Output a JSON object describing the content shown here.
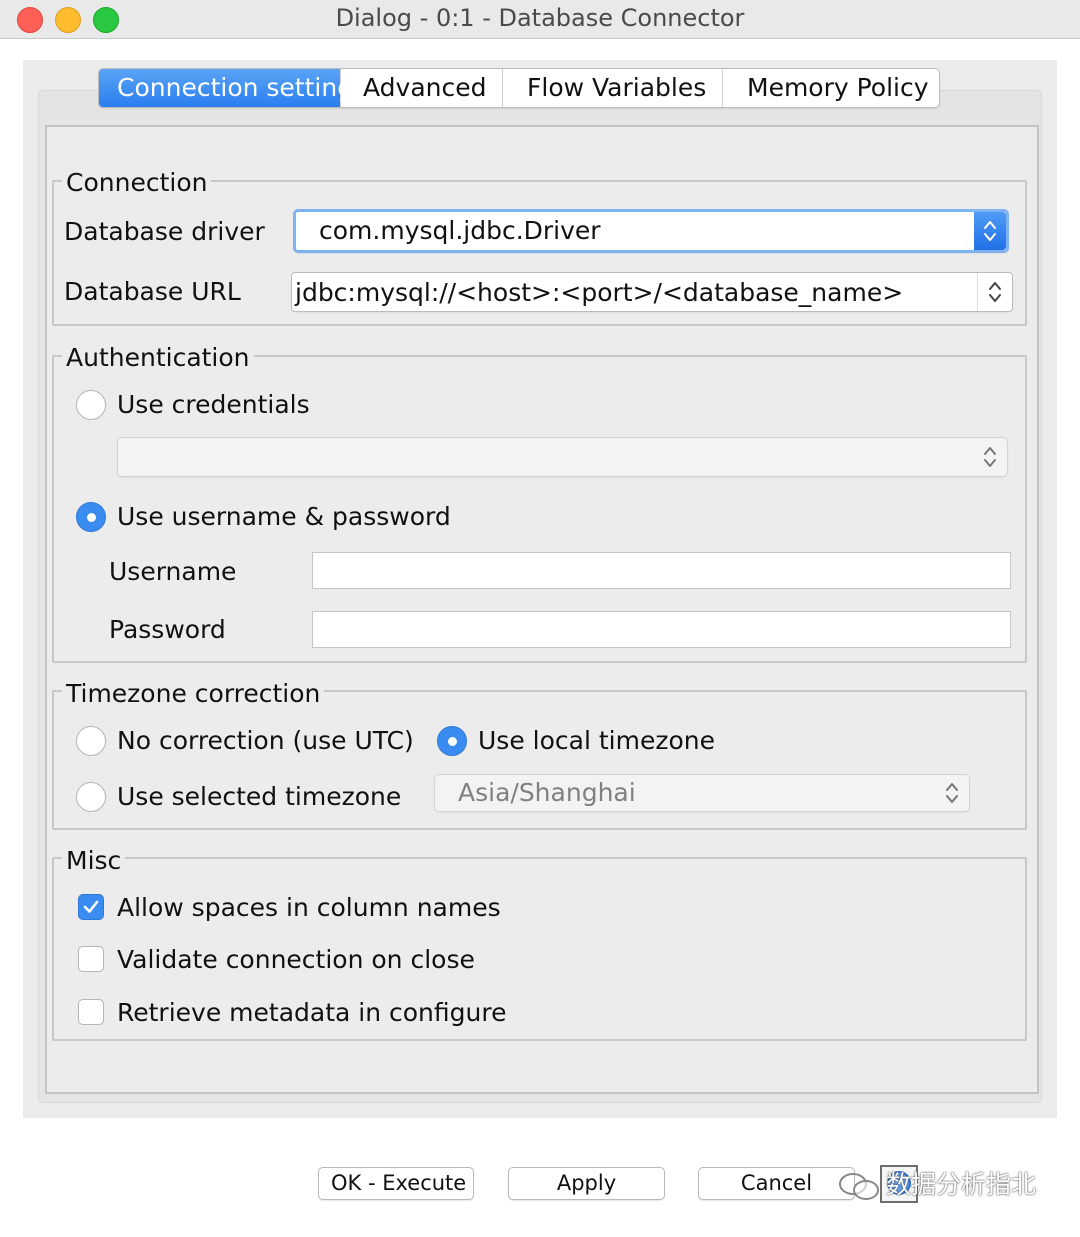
{
  "window": {
    "title": "Dialog - 0:1 - Database Connector"
  },
  "tabs": [
    {
      "label": "Connection settings",
      "active": true
    },
    {
      "label": "Advanced",
      "active": false
    },
    {
      "label": "Flow Variables",
      "active": false
    },
    {
      "label": "Memory Policy",
      "active": false
    }
  ],
  "connection": {
    "title": "Connection",
    "driver_label": "Database driver",
    "driver_value": "com.mysql.jdbc.Driver",
    "url_label": "Database URL",
    "url_value": "jdbc:mysql://<host>:<port>/<database_name>"
  },
  "authentication": {
    "title": "Authentication",
    "use_credentials_label": "Use credentials",
    "use_credentials_selected": false,
    "credentials_value": "",
    "use_userpass_label": "Use username & password",
    "use_userpass_selected": true,
    "username_label": "Username",
    "username_value": "",
    "password_label": "Password",
    "password_value": ""
  },
  "timezone": {
    "title": "Timezone correction",
    "no_correction_label": "No correction (use UTC)",
    "local_label": "Use local timezone",
    "selected_label": "Use selected timezone",
    "selected_option": "local",
    "timezone_value": "Asia/Shanghai"
  },
  "misc": {
    "title": "Misc",
    "allow_spaces_label": "Allow spaces in column names",
    "allow_spaces_checked": true,
    "validate_label": "Validate connection on close",
    "validate_checked": false,
    "retrieve_label": "Retrieve metadata in configure",
    "retrieve_checked": false
  },
  "buttons": {
    "ok_execute": "OK - Execute",
    "apply": "Apply",
    "cancel": "Cancel"
  },
  "watermark": {
    "text": "数据分析指北"
  },
  "colors": {
    "accent": "#3b8cf0",
    "close": "#fe5f57",
    "minimize": "#febc2e",
    "maximize": "#28c840"
  }
}
